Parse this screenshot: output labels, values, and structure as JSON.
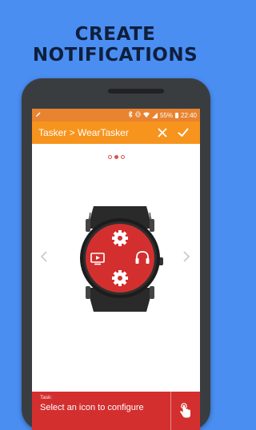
{
  "promo": {
    "title": "CREATE NOTIFICATIONS"
  },
  "status_bar": {
    "battery": "55%",
    "time": "22:40"
  },
  "app_bar": {
    "title": "Tasker > WearTasker"
  },
  "pager": {
    "count": 3,
    "active_index": 1
  },
  "watch_face": {
    "icons": [
      "gear-icon",
      "tv-icon",
      "headphones-icon",
      "gear-icon"
    ]
  },
  "bottom_bar": {
    "label": "Task:",
    "hint": "Select an icon to configure"
  },
  "colors": {
    "background": "#4a8ef2",
    "status_bar": "#e8842f",
    "app_bar": "#f7941d",
    "watch_face": "#d32f2f",
    "bottom_bar": "#d32f2f",
    "promo_text": "#0f1f3d"
  }
}
